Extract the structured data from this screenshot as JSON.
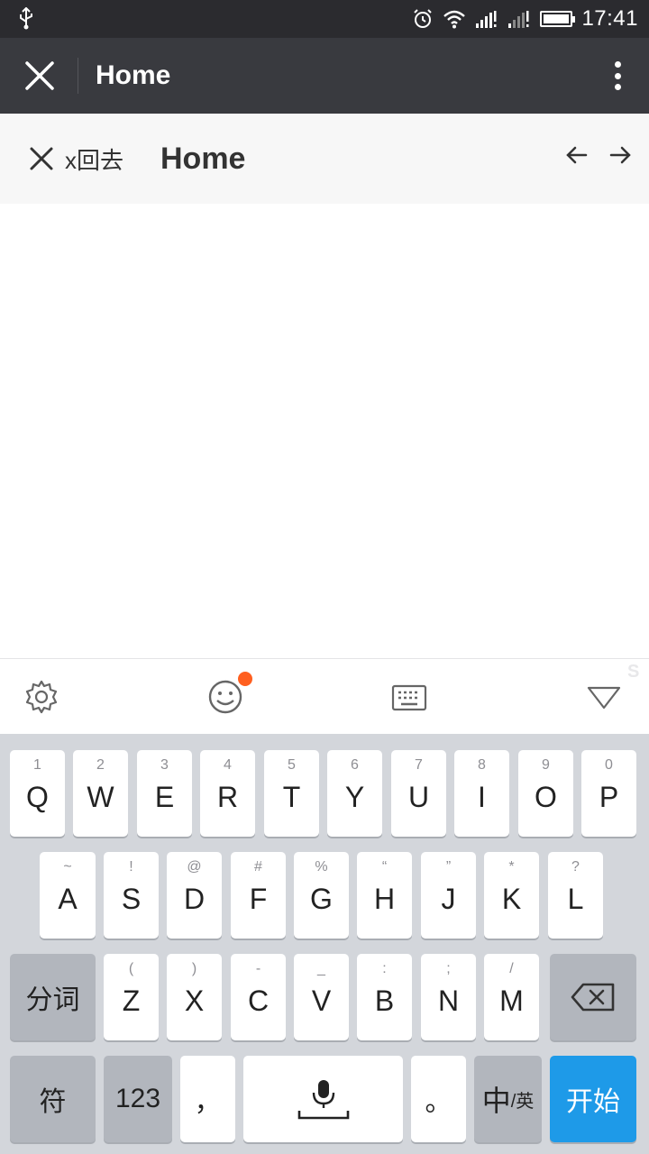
{
  "status_bar": {
    "time": "17:41"
  },
  "app_header": {
    "title": "Home"
  },
  "sub_nav": {
    "close_label": "x回去",
    "title": "Home"
  },
  "keyboard": {
    "row1": [
      {
        "hint": "1",
        "label": "Q"
      },
      {
        "hint": "2",
        "label": "W"
      },
      {
        "hint": "3",
        "label": "E"
      },
      {
        "hint": "4",
        "label": "R"
      },
      {
        "hint": "5",
        "label": "T"
      },
      {
        "hint": "6",
        "label": "Y"
      },
      {
        "hint": "7",
        "label": "U"
      },
      {
        "hint": "8",
        "label": "I"
      },
      {
        "hint": "9",
        "label": "O"
      },
      {
        "hint": "0",
        "label": "P"
      }
    ],
    "row2": [
      {
        "hint": "~",
        "label": "A"
      },
      {
        "hint": "!",
        "label": "S"
      },
      {
        "hint": "@",
        "label": "D"
      },
      {
        "hint": "#",
        "label": "F"
      },
      {
        "hint": "%",
        "label": "G"
      },
      {
        "hint": "“",
        "label": "H"
      },
      {
        "hint": "”",
        "label": "J"
      },
      {
        "hint": "*",
        "label": "K"
      },
      {
        "hint": "?",
        "label": "L"
      }
    ],
    "row3": [
      {
        "hint": "(",
        "label": "Z"
      },
      {
        "hint": ")",
        "label": "X"
      },
      {
        "hint": "-",
        "label": "C"
      },
      {
        "hint": "_",
        "label": "V"
      },
      {
        "hint": ":",
        "label": "B"
      },
      {
        "hint": ";",
        "label": "N"
      },
      {
        "hint": "/",
        "label": "M"
      }
    ],
    "segment_label": "分词",
    "symbol_label": "符",
    "numbers_label": "123",
    "comma_label": "，",
    "period_label": "。",
    "lang_main": "中",
    "lang_sub": "/英",
    "enter_label": "开始"
  },
  "colors": {
    "header_bg": "#393a3f",
    "status_bg": "#2b2b2f",
    "enter_blue": "#1e9ae8",
    "emoji_badge": "#ff5f1f"
  }
}
